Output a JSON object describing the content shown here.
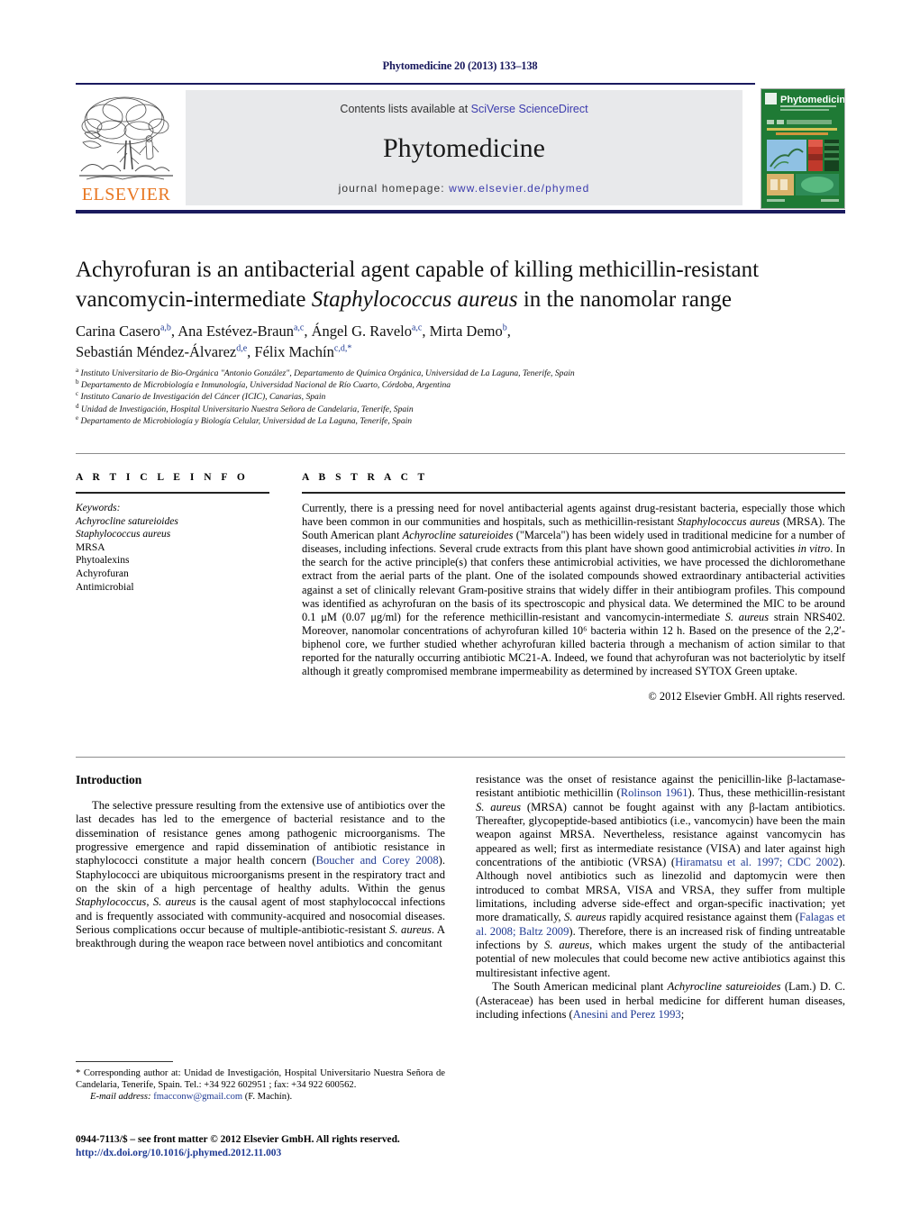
{
  "running_head": "Phytomedicine 20 (2013) 133–138",
  "masthead": {
    "contents_prefix": "Contents lists available at ",
    "sciencedirect": "SciVerse ScienceDirect",
    "journal_name": "Phytomedicine",
    "homepage_prefix": "journal homepage: ",
    "homepage_url": "www.elsevier.de/phymed",
    "publisher": "ELSEVIER",
    "cover_title": "Phytomedicine",
    "cover_subtitle": "International Journal of Phytotherapy and Phytopharmacology"
  },
  "article": {
    "title_line1": "Achyrofuran is an antibacterial agent capable of killing methicillin-resistant",
    "title_line2_a": "vancomycin-intermediate ",
    "title_line2_italic": "Staphylococcus aureus",
    "title_line2_b": " in the nanomolar range",
    "authors": [
      {
        "name": "Carina Casero",
        "sup": "a,b",
        "sep": ", "
      },
      {
        "name": "Ana Estévez-Braun",
        "sup": "a,c",
        "sep": ", "
      },
      {
        "name": "Ángel G. Ravelo",
        "sup": "a,c",
        "sep": ", "
      },
      {
        "name": "Mirta Demo",
        "sup": "b",
        "sep": ","
      },
      {
        "name": "Sebastián Méndez-Álvarez",
        "sup": "d,e",
        "sep": ", "
      },
      {
        "name": "Félix Machín",
        "sup": "c,d,*",
        "sep": ""
      }
    ],
    "affiliations": [
      {
        "mark": "a",
        "text": "Instituto Universitario de Bio-Orgánica \"Antonio González\", Departamento de Química Orgánica, Universidad de La Laguna, Tenerife, Spain"
      },
      {
        "mark": "b",
        "text": "Departamento de Microbiología e Inmunología, Universidad Nacional de Río Cuarto, Córdoba, Argentina"
      },
      {
        "mark": "c",
        "text": "Instituto Canario de Investigación del Cáncer (ICIC), Canarias, Spain"
      },
      {
        "mark": "d",
        "text": "Unidad de Investigación, Hospital Universitario Nuestra Señora de Candelaria, Tenerife, Spain"
      },
      {
        "mark": "e",
        "text": "Departamento de Microbiología y Biología Celular, Universidad de La Laguna, Tenerife, Spain"
      }
    ]
  },
  "article_info": {
    "heading": "A R T I C L E   I N F O",
    "keywords_label": "Keywords:",
    "keywords": [
      "Achyrocline satureioides",
      "Staphylococcus aureus",
      "MRSA",
      "Phytoalexins",
      "Achyrofuran",
      "Antimicrobial"
    ]
  },
  "abstract": {
    "heading": "A B S T R A C T",
    "p1": "Currently, there is a pressing need for novel antibacterial agents against drug-resistant bacteria, especially those which have been common in our communities and hospitals, such as methicillin-resistant ",
    "sp1": "Staphylococcus aureus",
    "p2": " (MRSA). The South American plant ",
    "sp2": "Achyrocline satureioides",
    "p3": " (\"Marcela\") has been widely used in traditional medicine for a number of diseases, including infections. Several crude extracts from this plant have shown good antimicrobial activities ",
    "sp3": "in vitro",
    "p4": ". In the search for the active principle(s) that confers these antimicrobial activities, we have processed the dichloromethane extract from the aerial parts of the plant. One of the isolated compounds showed extraordinary antibacterial activities against a set of clinically relevant Gram-positive strains that widely differ in their antibiogram profiles. This compound was identified as achyrofuran on the basis of its spectroscopic and physical data. We determined the MIC to be around 0.1 μM (0.07 μg/ml) for the reference methicillin-resistant and vancomycin-intermediate ",
    "sp4": "S. aureus",
    "p5": " strain NRS402. Moreover, nanomolar concentrations of achyrofuran killed 10⁶ bacteria within 12 h. Based on the presence of the 2,2′-biphenol core, we further studied whether achyrofuran killed bacteria through a mechanism of action similar to that reported for the naturally occurring antibiotic MC21-A. Indeed, we found that achyrofuran was not bacteriolytic by itself although it greatly compromised membrane impermeability as determined by increased SYTOX Green uptake.",
    "copyright": "© 2012 Elsevier GmbH. All rights reserved."
  },
  "introduction": {
    "heading": "Introduction",
    "left_p1_a": "The selective pressure resulting from the extensive use of antibiotics over the last decades has led to the emergence of bacterial resistance and to the dissemination of resistance genes among pathogenic microorganisms. The progressive emergence and rapid dissemination of antibiotic resistance in staphylococci constitute a major health concern (",
    "left_cite1": "Boucher and Corey 2008",
    "left_p1_b": "). Staphylococci are ubiquitous microorganisms present in the respiratory tract and on the skin of a high percentage of healthy adults. Within the genus ",
    "left_it1": "Staphylococcus",
    "left_p1_c": ", ",
    "left_it2": "S. aureus",
    "left_p1_d": " is the causal agent of most staphylococcal infections and is frequently associated with community-acquired and nosocomial diseases. Serious complications occur because of multiple-antibiotic-resistant ",
    "left_it3": "S. aureus",
    "left_p1_e": ". A breakthrough during the weapon race between novel antibiotics and concomitant",
    "right_p1_a": "resistance was the onset of resistance against the penicillin-like β-lactamase-resistant antibiotic methicillin (",
    "right_cite1": "Rolinson 1961",
    "right_p1_b": "). Thus, these methicillin-resistant ",
    "right_it1": "S. aureus",
    "right_p1_c": " (MRSA) cannot be fought against with any β-lactam antibiotics. Thereafter, glycopeptide-based antibiotics (i.e., vancomycin) have been the main weapon against MRSA. Nevertheless, resistance against vancomycin has appeared as well; first as intermediate resistance (VISA) and later against high concentrations of the antibiotic (VRSA) (",
    "right_cite2": "Hiramatsu et al. 1997; CDC 2002",
    "right_p1_d": "). Although novel antibiotics such as linezolid and daptomycin were then introduced to combat MRSA, VISA and VRSA, they suffer from multiple limitations, including adverse side-effect and organ-specific inactivation; yet more dramatically, ",
    "right_it2": "S. aureus",
    "right_p1_e": " rapidly acquired resistance against them (",
    "right_cite3": "Falagas et al. 2008; Baltz 2009",
    "right_p1_f": "). Therefore, there is an increased risk of finding untreatable infections by ",
    "right_it3": "S. aureus",
    "right_p1_g": ", which makes urgent the study of the antibacterial potential of new molecules that could become new active antibiotics against this multiresistant infective agent.",
    "right_p2_a": "The South American medicinal plant ",
    "right_it4": "Achyrocline satureioides",
    "right_p2_b": " (Lam.) D. C. (Asteraceae) has been used in herbal medicine for different human diseases, including infections (",
    "right_cite4": "Anesini and Perez 1993",
    "right_p2_c": ";"
  },
  "footnote": {
    "corresponding": "* Corresponding author at: Unidad de Investigación, Hospital Universitario Nuestra Señora de Candelaria, Tenerife, Spain. Tel.: +34 922 602951 ; fax: +34 922 600562.",
    "email_label": "E-mail address:",
    "email": "fmacconw@gmail.com",
    "email_suffix": "(F. Machín)."
  },
  "imprint": {
    "line1": "0944-7113/$ – see front matter © 2012 Elsevier GmbH. All rights reserved.",
    "doi": "http://dx.doi.org/10.1016/j.phymed.2012.11.003"
  },
  "colors": {
    "navy": "#1a1a5e",
    "link_blue": "#1f3a93",
    "sciencedirect_blue": "#3b3bad",
    "elsevier_orange": "#e87722",
    "cover_green": "#1f7a35",
    "masthead_grey": "#e8e9eb"
  }
}
